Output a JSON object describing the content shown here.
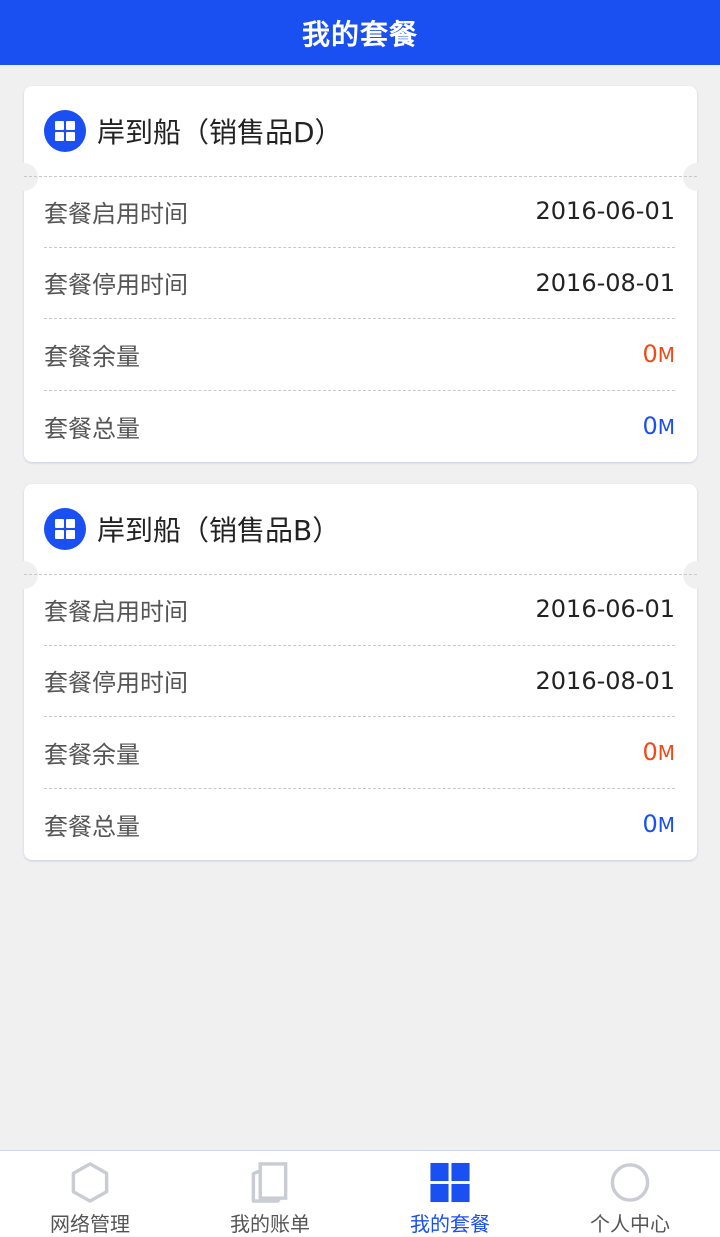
{
  "header": {
    "title": "我的套餐"
  },
  "packages": [
    {
      "title": "岸到船（销售品D）",
      "rows": [
        {
          "label": "套餐启用时间",
          "value": "2016-06-01"
        },
        {
          "label": "套餐停用时间",
          "value": "2016-08-01"
        },
        {
          "label": "套餐余量",
          "value": "0",
          "unit": "M"
        },
        {
          "label": "套餐总量",
          "value": "0",
          "unit": "M"
        }
      ]
    },
    {
      "title": "岸到船（销售品B）",
      "rows": [
        {
          "label": "套餐启用时间",
          "value": "2016-06-01"
        },
        {
          "label": "套餐停用时间",
          "value": "2016-08-01"
        },
        {
          "label": "套餐余量",
          "value": "0",
          "unit": "M"
        },
        {
          "label": "套餐总量",
          "value": "0",
          "unit": "M"
        }
      ]
    }
  ],
  "tabbar": {
    "items": [
      {
        "label": "网络管理",
        "icon": "hexagon-icon"
      },
      {
        "label": "我的账单",
        "icon": "bill-icon"
      },
      {
        "label": "我的套餐",
        "icon": "grid-icon",
        "active": true
      },
      {
        "label": "个人中心",
        "icon": "person-circle-icon"
      }
    ]
  },
  "colors": {
    "primary": "#1a4ff2",
    "remaining": "#f04a16",
    "total": "#1a4ff2",
    "inactive_icon": "#c9ccd3",
    "background": "#f0f0f0"
  }
}
